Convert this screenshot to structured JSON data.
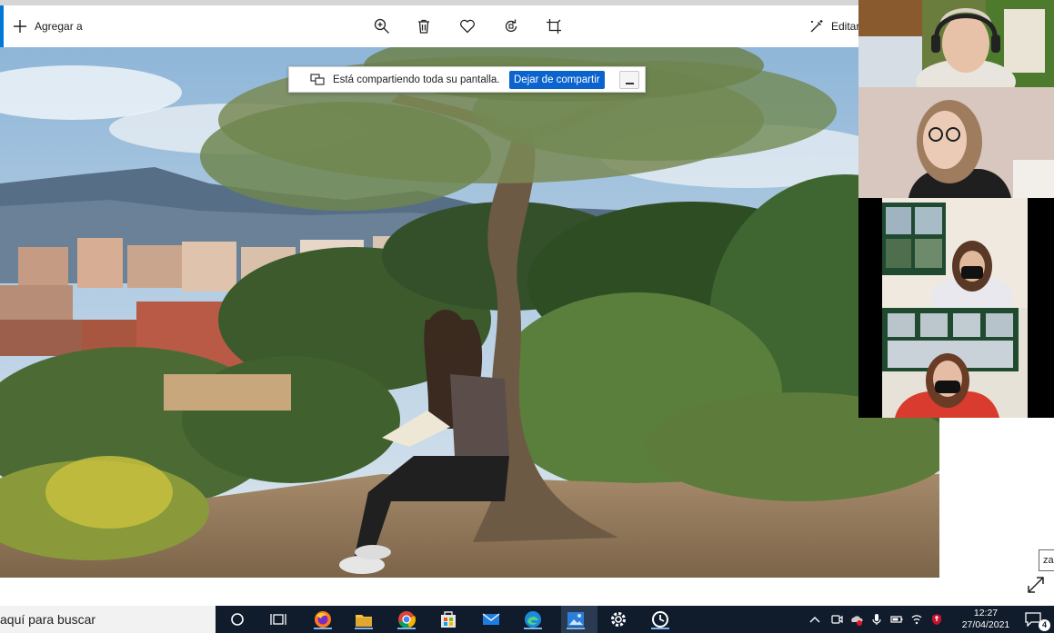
{
  "toolbar": {
    "add_label": "Agregar a",
    "edit_label": "Editar",
    "icons": [
      "zoom-icon",
      "trash-icon",
      "heart-icon",
      "rotate-icon",
      "crop-icon"
    ]
  },
  "share_banner": {
    "message": "Está compartiendo toda su pantalla.",
    "stop_label": "Dejar de compartir"
  },
  "video_tiles": [
    {
      "participant": "participant-1"
    },
    {
      "participant": "participant-2"
    },
    {
      "participant": "participant-3"
    },
    {
      "participant": "participant-4"
    }
  ],
  "side_hint": "za",
  "taskbar": {
    "search_text": "aquí para buscar",
    "apps": [
      "cortana",
      "task-view",
      "firefox",
      "file-explorer",
      "chrome",
      "store",
      "mail",
      "edge",
      "photos",
      "settings",
      "clock-app"
    ],
    "time": "12:27",
    "date": "27/04/2021",
    "notification_count": "4"
  },
  "colors": {
    "accent": "#0078d4",
    "share_button": "#0b63ce",
    "taskbar": "#101c2c"
  }
}
